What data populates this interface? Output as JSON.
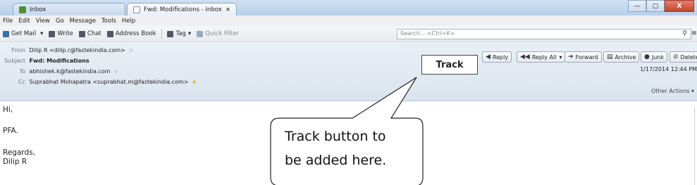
{
  "window": {
    "tabs": [
      {
        "label": "Inbox",
        "icon": "inbox-icon"
      },
      {
        "label": "Fwd: Modifications - Inbox",
        "icon": "envelope-icon",
        "close": "×"
      }
    ],
    "controls": {
      "minimize": "—",
      "maximize": "▢",
      "close": "X"
    }
  },
  "menubar": [
    "File",
    "Edit",
    "View",
    "Go",
    "Message",
    "Tools",
    "Help"
  ],
  "toolbar": {
    "get_mail": "Get Mail",
    "write": "Write",
    "chat": "Chat",
    "address_book": "Address Book",
    "tag": "Tag",
    "quick_filter": "Quick Filter",
    "search_placeholder": "Search... <Ctrl+K>"
  },
  "message": {
    "from_label": "From",
    "from_value": "Dilip R <dilip.r@fastekindia.com>",
    "subject_label": "Subject",
    "subject_value": "Fwd: Modifications",
    "to_label": "To",
    "to_value": "abhishek.k@fastekindia.com",
    "cc_label": "Cc",
    "cc_value": "Suprabhat Mohapatra <suprabhat.m@fastekindia.com>",
    "date": "1/17/2014 12:44 PM",
    "other_actions": "Other Actions ▾"
  },
  "actions": {
    "reply": "Reply",
    "reply_all": "Reply All",
    "forward": "Forward",
    "archive": "Archive",
    "junk": "Junk",
    "delete": "Delete"
  },
  "annotation": {
    "track_button": "Track",
    "callout_line1": "Track button to",
    "callout_line2": "be added here."
  },
  "body": {
    "line1": "Hi,",
    "line2": "PFA.",
    "line3": "Regards,",
    "line4": "Dilip R"
  }
}
